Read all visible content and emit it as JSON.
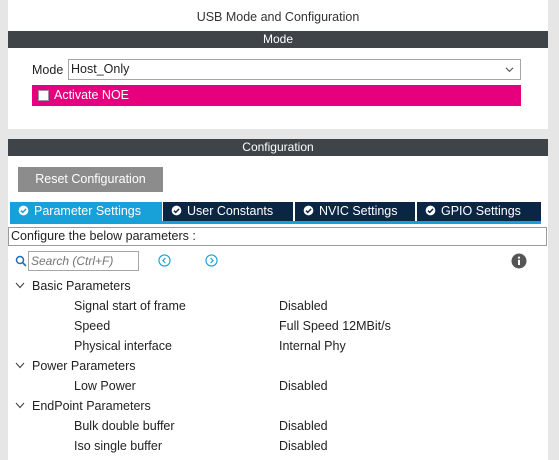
{
  "window": {
    "title": "USB Mode and Configuration"
  },
  "mode_section": {
    "header": "Mode",
    "mode_label": "Mode",
    "mode_value": "Host_Only",
    "noe_label": "Activate NOE",
    "noe_checked": false,
    "noe_color": "#e6007e"
  },
  "config_section": {
    "header": "Configuration",
    "reset_label": "Reset Configuration",
    "tabs": [
      {
        "label": "Parameter Settings",
        "active": true,
        "icon": "check-circle-icon"
      },
      {
        "label": "User Constants",
        "active": false,
        "icon": "check-circle-icon"
      },
      {
        "label": "NVIC Settings",
        "active": false,
        "icon": "check-circle-icon"
      },
      {
        "label": "GPIO Settings",
        "active": false,
        "icon": "check-circle-icon"
      }
    ],
    "instruction": "Configure the below parameters :",
    "search_placeholder": "Search (Ctrl+F)",
    "groups": [
      {
        "name": "Basic Parameters",
        "params": [
          {
            "name": "Signal start of frame",
            "value": "Disabled"
          },
          {
            "name": "Speed",
            "value": "Full Speed 12MBit/s"
          },
          {
            "name": "Physical interface",
            "value": "Internal Phy"
          }
        ]
      },
      {
        "name": "Power Parameters",
        "params": [
          {
            "name": "Low Power",
            "value": "Disabled"
          }
        ]
      },
      {
        "name": "EndPoint Parameters",
        "params": [
          {
            "name": "Bulk double buffer",
            "value": "Disabled"
          },
          {
            "name": "Iso single buffer",
            "value": "Disabled"
          }
        ]
      }
    ]
  },
  "colors": {
    "header_bar": "#3f4449",
    "tab_active": "#18a1d8",
    "tab_inactive": "#0b2545",
    "reset_button": "#8c8c8c",
    "nav_icon": "#18a1d8"
  }
}
